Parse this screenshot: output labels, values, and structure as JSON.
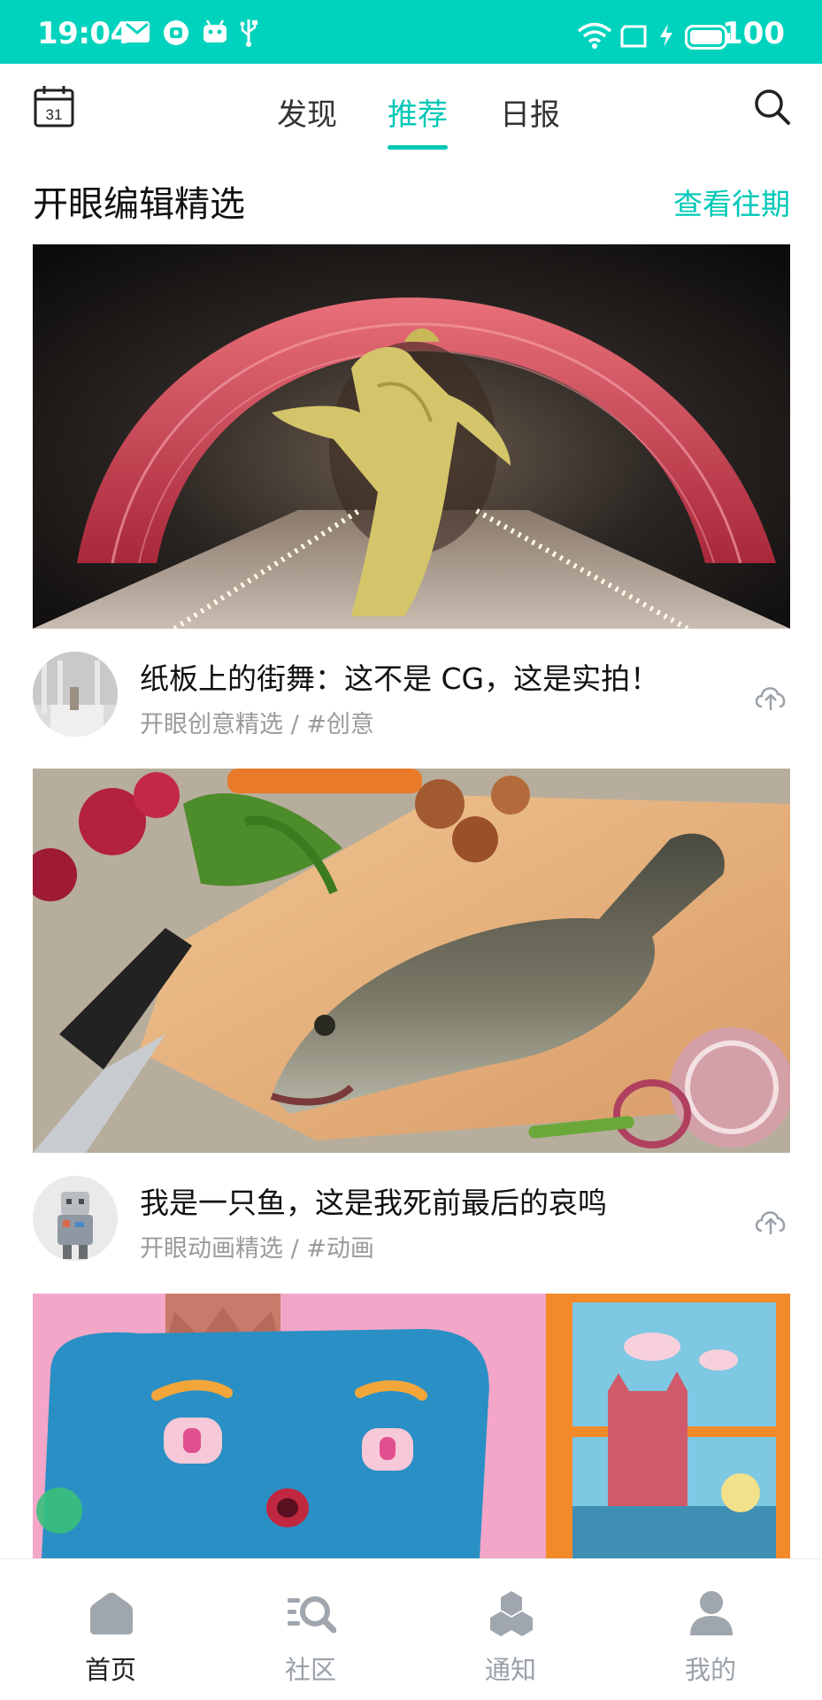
{
  "status_bar": {
    "time": "19:04",
    "battery": "100",
    "icons": [
      "mail-icon",
      "camera-notif-icon",
      "android-icon",
      "usb-icon",
      "wifi-icon",
      "screen-icon",
      "charging-icon",
      "battery-icon"
    ]
  },
  "top_nav": {
    "calendar_day": "31",
    "tabs": [
      {
        "label": "发现",
        "active": false
      },
      {
        "label": "推荐",
        "active": true
      },
      {
        "label": "日报",
        "active": false
      }
    ],
    "accent": "#00c8b6"
  },
  "section": {
    "title": "开眼编辑精选",
    "link": "查看往期"
  },
  "cards": [
    {
      "image": "paper-sculpture-dancer-photo",
      "avatar": "white-room-avatar",
      "title": "纸板上的街舞：这不是 CG，这是实拍！",
      "subtitle": "开眼创意精选 / #创意"
    },
    {
      "image": "fish-on-cutting-board-photo",
      "avatar": "robot-figure-avatar",
      "title": "我是一只鱼，这是我死前最后的哀鸣",
      "subtitle": "开眼动画精选 / #动画"
    },
    {
      "image": "clay-blue-character-animation-still"
    }
  ],
  "bottom_bar": {
    "items": [
      {
        "label": "首页",
        "icon": "home-icon",
        "active": true
      },
      {
        "label": "社区",
        "icon": "community-icon",
        "active": false
      },
      {
        "label": "通知",
        "icon": "notification-icon",
        "active": false
      },
      {
        "label": "我的",
        "icon": "profile-icon",
        "active": false
      }
    ]
  },
  "colors": {
    "status_bar": "#00d3bd",
    "accent": "#00c8b6",
    "inactive_icon": "#9aa1a8"
  }
}
